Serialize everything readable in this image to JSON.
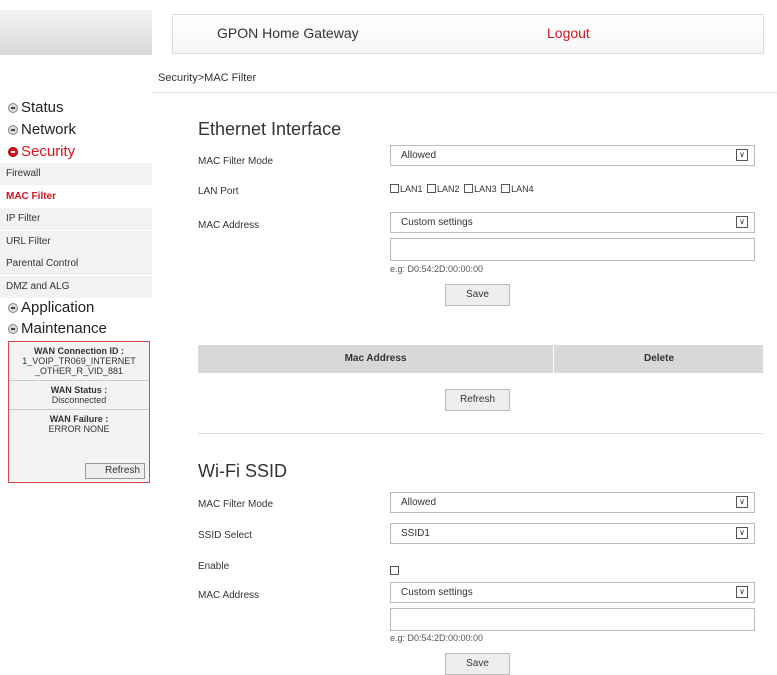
{
  "header": {
    "title": "GPON Home Gateway",
    "logout": "Logout"
  },
  "breadcrumb": "Security>MAC Filter",
  "sidebar": {
    "items": [
      {
        "label": "Status"
      },
      {
        "label": "Network"
      },
      {
        "label": "Security"
      },
      {
        "label": "Application"
      },
      {
        "label": "Maintenance"
      }
    ],
    "sub": [
      {
        "label": "Firewall"
      },
      {
        "label": "MAC Filter"
      },
      {
        "label": "IP Filter"
      },
      {
        "label": "URL Filter"
      },
      {
        "label": "Parental Control"
      },
      {
        "label": "DMZ and ALG"
      }
    ]
  },
  "wan": {
    "conn_label": "WAN Connection ID :",
    "conn_value": "1_VOIP_TR069_INTERNET _OTHER_R_VID_881",
    "status_label": "WAN Status :",
    "status_value": "Disconnected",
    "failure_label": "WAN Failure :",
    "failure_value": "ERROR NONE",
    "refresh": "Refresh"
  },
  "ethernet": {
    "title": "Ethernet Interface",
    "mode_label": "MAC Filter Mode",
    "mode_value": "Allowed",
    "lan_label": "LAN Port",
    "lan_ports": [
      "LAN1",
      "LAN2",
      "LAN3",
      "LAN4"
    ],
    "mac_label": "MAC Address",
    "mac_value": "Custom settings",
    "hint": "e.g: D0:54:2D:00:00:00",
    "save": "Save",
    "table_headers": [
      "Mac Address",
      "Delete"
    ],
    "refresh": "Refresh"
  },
  "wifi": {
    "title": "Wi-Fi SSID",
    "mode_label": "MAC Filter Mode",
    "mode_value": "Allowed",
    "ssid_label": "SSID Select",
    "ssid_value": "SSID1",
    "enable_label": "Enable",
    "mac_label": "MAC Address",
    "mac_value": "Custom settings",
    "hint": "e.g: D0:54:2D:00:00:00",
    "save": "Save"
  },
  "colors": {
    "accent": "#d4161c"
  }
}
